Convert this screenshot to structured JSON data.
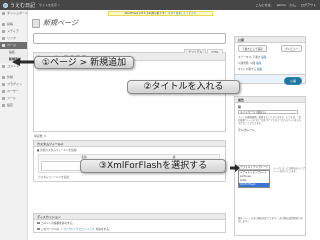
{
  "header": {
    "site_title": "うえむ日記",
    "site_sub": "サイトを表示 »",
    "user_links": [
      "こんにちは、",
      "admin",
      "さん。",
      "ログアウト"
    ]
  },
  "nag": {
    "text": "WordPress 2.8.4 が利用可能です！",
    "link": "今すぐ更新してください"
  },
  "sidebar": {
    "items": [
      {
        "label": "ダッシュボード",
        "state": "normal"
      },
      {
        "label": "",
        "state": "sep"
      },
      {
        "label": "投稿",
        "state": "normal"
      },
      {
        "label": "メディア",
        "state": "normal"
      },
      {
        "label": "リンク",
        "state": "normal"
      },
      {
        "label": "ページ",
        "state": "active"
      },
      {
        "label": "編集",
        "state": "sub"
      },
      {
        "label": "新規追加",
        "state": "sub-current"
      },
      {
        "label": "コメント",
        "state": "normal"
      },
      {
        "label": "",
        "state": "sep"
      },
      {
        "label": "外観",
        "state": "normal"
      },
      {
        "label": "プラグイン",
        "state": "normal"
      },
      {
        "label": "ユーザー",
        "state": "normal"
      },
      {
        "label": "ツール",
        "state": "normal"
      },
      {
        "label": "設定",
        "state": "normal"
      }
    ]
  },
  "page": {
    "title": "新規ページ"
  },
  "editor": {
    "media_label": "アップロード/挿入",
    "tabs": [
      "ビジュアル",
      "HTML"
    ],
    "word_count": "単語数: 0"
  },
  "custom_fields": {
    "heading": "カスタムフィールド",
    "note": "■ 新規カスタムフィールドを追加:",
    "col_name": "名前",
    "col_value": "値",
    "add_button": "カスタムフィールドを追加",
    "help_text": "カスタムフィールドはあなたの投稿に独自のメタデータを追加するために使います。テンプレートで使うことができます。",
    "help_link": "カスタムフィールドの使い方"
  },
  "discussion": {
    "heading": "ディスカッション",
    "allow_comments": "コメントの投稿を許可する。",
    "allow_pings": "このページへの",
    "pings_link": "トラックバックとピンバック",
    "pings_tail": "を許可する。"
  },
  "publish": {
    "heading": "公開",
    "save_draft": "下書きとして保存",
    "preview": "プレビュー",
    "status": "ステータス: 下書き",
    "status_edit": "編集",
    "visibility": "公開状態: 公開",
    "visibility_edit": "編集",
    "schedule": "すぐに公開する",
    "schedule_edit": "編集",
    "publish_button": "公開"
  },
  "attributes": {
    "heading": "属性",
    "parent_label": "親",
    "parent_value": "メインページ (親なし)",
    "parent_desc": "ページを階層構造に整理することができます。たとえば、“会社概要”ページの下に“沿革”や“アクセス”などのページをぶら下げることができます。",
    "template_label": "テンプレート",
    "template_value": "デフォルトテンプレート",
    "template_options": [
      "デフォルトテンプレート",
      "Archives",
      "Links",
      "XmlForFlash"
    ],
    "template_highlight": 3,
    "template_desc": "テーマによっては独自のテンプレートを持っています。",
    "order_desc": "順序: ページの並び順を指定できます。（並び順は通常数値で指定します。）"
  },
  "annotations": {
    "step1": "①ページ > 新規追加",
    "step2": "②タイトルを入れる",
    "step3": "③XmlForFlashを選択する"
  }
}
